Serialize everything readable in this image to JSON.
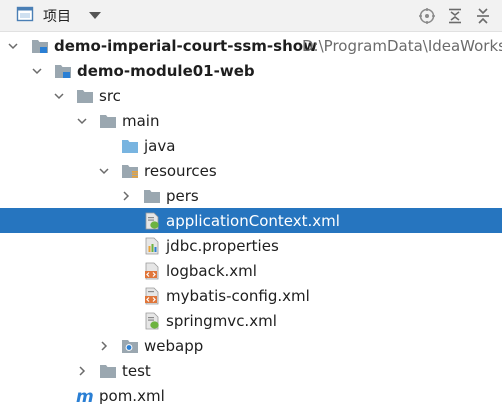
{
  "toolbar": {
    "title": "项目",
    "icons": [
      "project-view-icon",
      "dropdown-arrow-icon",
      "locate-icon",
      "expand-all-icon",
      "collapse-all-icon"
    ]
  },
  "tree": {
    "root": {
      "label": "demo-imperial-court-ssm-show",
      "path": "D:\\ProgramData\\IdeaWorks"
    },
    "module": {
      "label": "demo-module01-web"
    },
    "src": "src",
    "main": "main",
    "java": "java",
    "resources": "resources",
    "pers": "pers",
    "files": {
      "applicationContext": "applicationContext.xml",
      "jdbc": "jdbc.properties",
      "logback": "logback.xml",
      "mybatis": "mybatis-config.xml",
      "springmvc": "springmvc.xml"
    },
    "webapp": "webapp",
    "test": "test",
    "pom": "pom.xml",
    "selected": "applicationContext.xml"
  },
  "colors": {
    "selection": "#2675bf",
    "folder": "#9aa7b0",
    "source_folder": "#78b4e0",
    "xml_orange": "#e0763a",
    "spring_green": "#6db33f",
    "maven_blue": "#2a7fd4"
  }
}
